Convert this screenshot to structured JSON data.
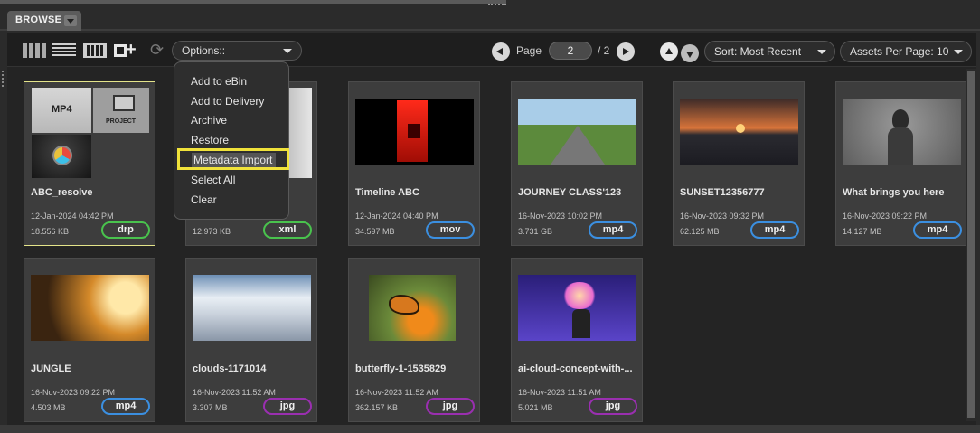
{
  "tab": {
    "label": "BROWSE"
  },
  "toolbar": {
    "options_label": "Options::",
    "page_label": "Page",
    "page_value": "2",
    "page_total": "/ 2",
    "sort_label": "Sort: Most Recent",
    "per_page_label": "Assets Per Page: 10"
  },
  "menu": {
    "items": [
      "Add to eBin",
      "Add to Delivery",
      "Archive",
      "Restore",
      "Metadata Import",
      "Select All",
      "Clear"
    ]
  },
  "assets": [
    {
      "title": "ABC_resolve",
      "date": "12-Jan-2024 04:42 PM",
      "size": "18.556 KB",
      "type": "drp",
      "badge_color": "#49c24d"
    },
    {
      "title": "",
      "date": "",
      "size": "12.973 KB",
      "type": "xml",
      "badge_color": "#49c24d"
    },
    {
      "title": "Timeline ABC",
      "date": "12-Jan-2024 04:40 PM",
      "size": "34.597 MB",
      "type": "mov",
      "badge_color": "#3b8fe0"
    },
    {
      "title": "JOURNEY CLASS'123",
      "date": "16-Nov-2023 10:02 PM",
      "size": "3.731 GB",
      "type": "mp4",
      "badge_color": "#3b8fe0"
    },
    {
      "title": "SUNSET12356777",
      "date": "16-Nov-2023 09:32 PM",
      "size": "62.125 MB",
      "type": "mp4",
      "badge_color": "#3b8fe0"
    },
    {
      "title": "What brings you here",
      "date": "16-Nov-2023 09:22 PM",
      "size": "14.127 MB",
      "type": "mp4",
      "badge_color": "#3b8fe0"
    },
    {
      "title": "JUNGLE",
      "date": "16-Nov-2023 09:22 PM",
      "size": "4.503 MB",
      "type": "mp4",
      "badge_color": "#3b8fe0"
    },
    {
      "title": "clouds-1171014",
      "date": "16-Nov-2023 11:52 AM",
      "size": "3.307 MB",
      "type": "jpg",
      "badge_color": "#9a2fb0"
    },
    {
      "title": "butterfly-1-1535829",
      "date": "16-Nov-2023 11:52 AM",
      "size": "362.157 KB",
      "type": "jpg",
      "badge_color": "#9a2fb0"
    },
    {
      "title": "ai-cloud-concept-with-...",
      "date": "16-Nov-2023 11:51 AM",
      "size": "5.021 MB",
      "type": "jpg",
      "badge_color": "#9a2fb0"
    }
  ],
  "resolve_thumb": {
    "mp4_label": "MP4",
    "project_label": "PROJECT"
  }
}
